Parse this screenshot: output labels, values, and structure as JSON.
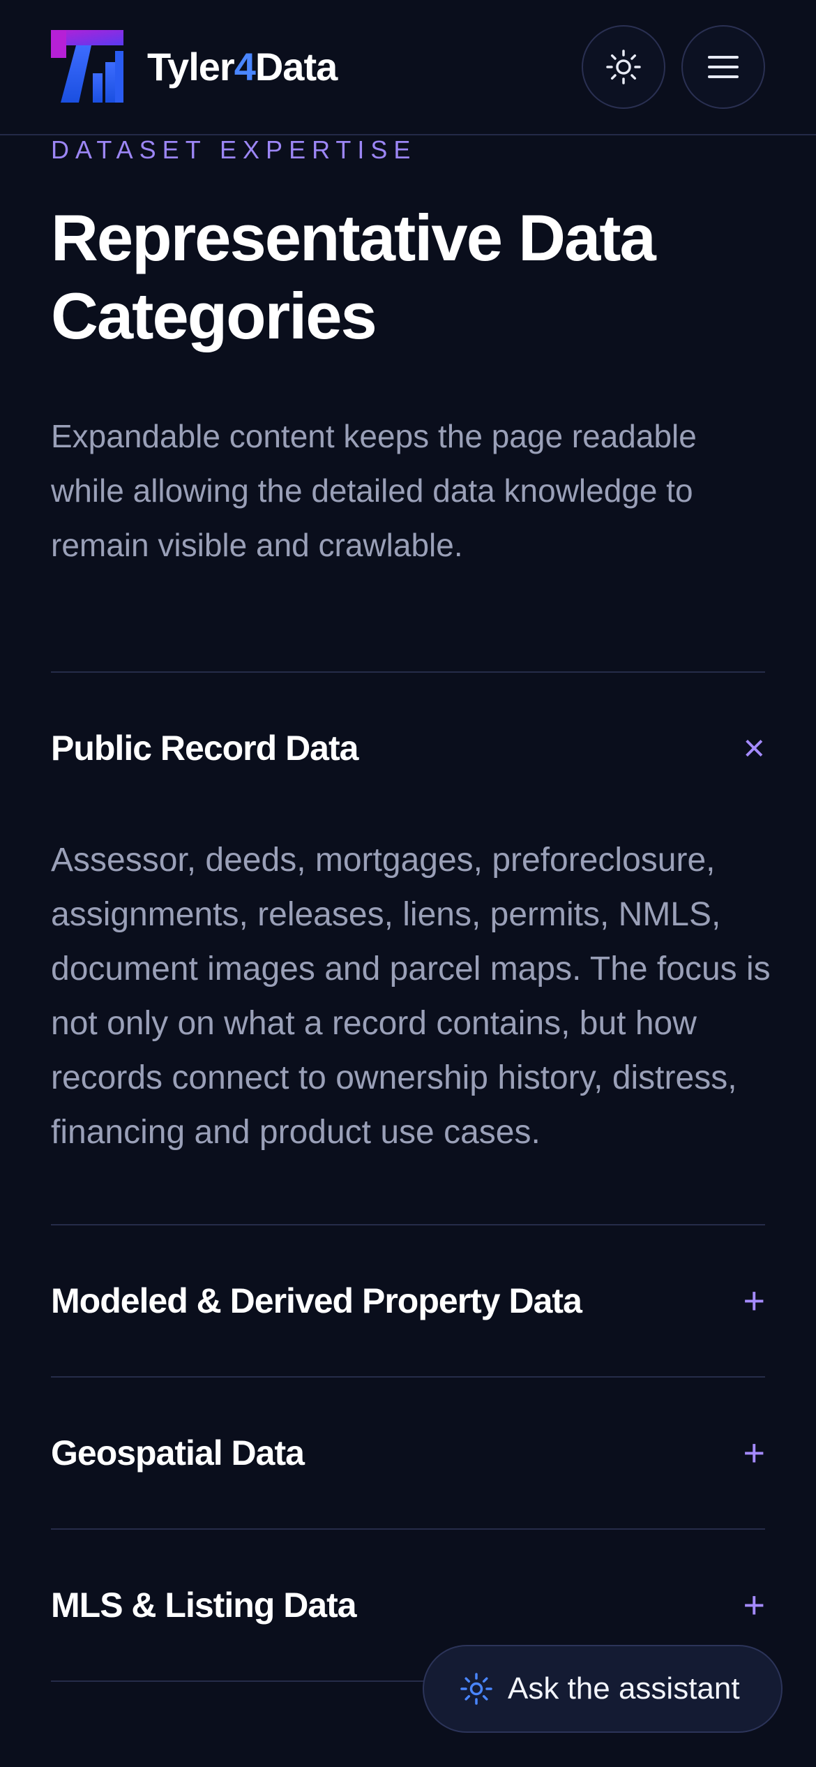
{
  "header": {
    "brand": {
      "name_part1": "Tyler",
      "name_accent": "4",
      "name_part2": "Data"
    },
    "theme_toggle_icon": "sun-icon",
    "menu_icon": "hamburger-menu-icon"
  },
  "intro": {
    "eyebrow": "DATASET EXPERTISE",
    "title": "Representative Data Categories",
    "lead": "Expandable content keeps the page readable while allowing the detailed data knowledge to remain visible and crawlable."
  },
  "accordion": [
    {
      "title": "Public Record Data",
      "expanded": true,
      "toggle": "×",
      "body": "Assessor, deeds, mortgages, preforeclosure, assignments, releases, liens, permits, NMLS, document images and parcel maps. The focus is not only on what a record contains, but how records connect to ownership history, distress, financing and product use cases."
    },
    {
      "title": "Modeled & Derived Property Data",
      "expanded": false,
      "toggle": "+"
    },
    {
      "title": "Geospatial Data",
      "expanded": false,
      "toggle": "+"
    },
    {
      "title": "MLS & Listing Data",
      "expanded": false,
      "toggle": "+"
    }
  ],
  "assistant": {
    "label": "Ask the assistant",
    "icon": "sparkle-icon"
  },
  "colors": {
    "background": "#0a0e1c",
    "accent_purple": "#9c86f5",
    "accent_blue": "#4a86ff",
    "muted_text": "#9aa0b8",
    "divider": "#262c49"
  }
}
